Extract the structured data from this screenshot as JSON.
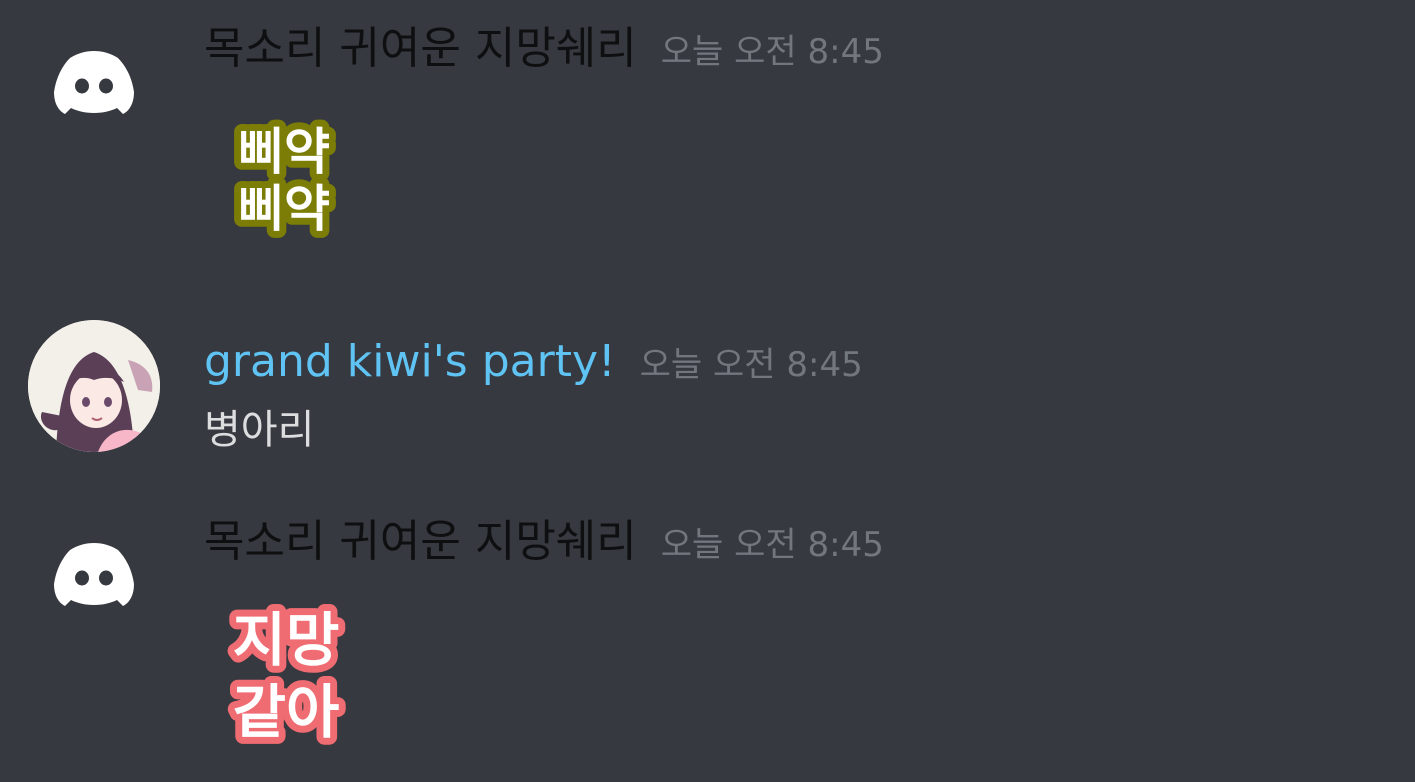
{
  "messages": [
    {
      "username": "목소리 귀여운 지망쉐리",
      "timestamp": "오늘 오전 8:45",
      "sticker_text": [
        "삐약",
        "삐약"
      ],
      "sticker_fill": "#ffffff",
      "sticker_outline": "#7c7d06"
    },
    {
      "username": "grand kiwi's party!",
      "timestamp": "오늘 오전 8:45",
      "text": "병아리"
    },
    {
      "username": "목소리 귀여운 지망쉐리",
      "timestamp": "오늘 오전 8:45",
      "sticker_text": [
        "지망",
        "같아"
      ],
      "sticker_fill": "#ffffff",
      "sticker_outline": "#f06c73"
    }
  ],
  "colors": {
    "background": "#36393f",
    "username_link": "#5fc3f3",
    "timestamp": "#72767d",
    "text": "#dcddde"
  }
}
